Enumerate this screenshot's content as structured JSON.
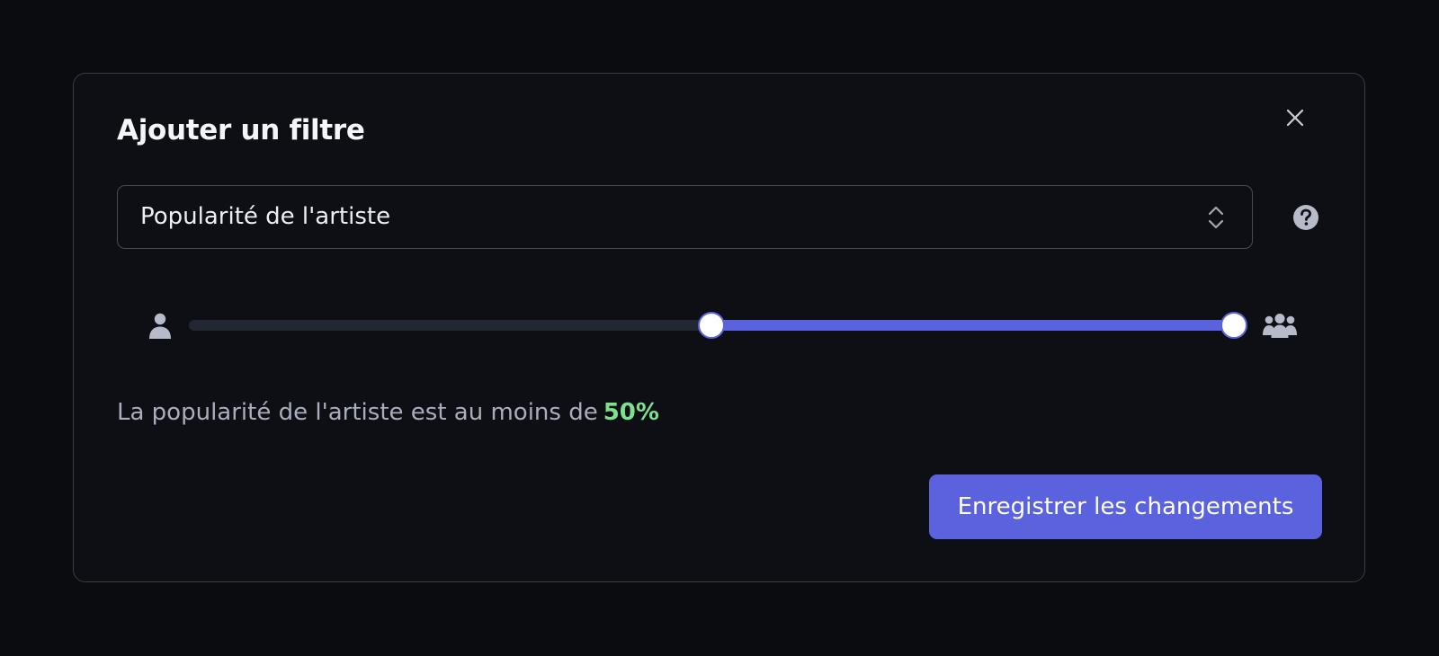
{
  "modal": {
    "title": "Ajouter un filtre",
    "close_icon": "close-icon"
  },
  "filter_select": {
    "value": "Popularité de l'artiste",
    "icon": "chevron-up-down-icon"
  },
  "help": {
    "icon": "question-circle-icon"
  },
  "slider": {
    "min_icon": "single-person-icon",
    "max_icon": "group-people-icon",
    "lower_value_percent": 50,
    "upper_value_percent": 100,
    "fill_color": "#5b62dd",
    "track_color": "#232633"
  },
  "summary": {
    "text": "La popularité de l'artiste est au moins de",
    "value": "50%",
    "value_color": "#7ee08f"
  },
  "actions": {
    "save_label": "Enregistrer les changements",
    "save_color": "#5b62dd"
  }
}
